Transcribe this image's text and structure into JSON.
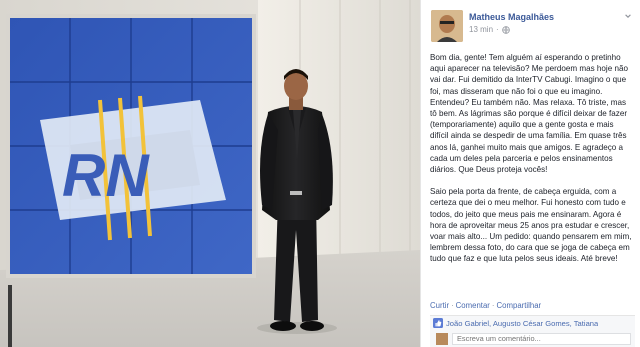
{
  "post": {
    "author": "Matheus Magalhães",
    "time": "13 min",
    "separator": "·",
    "paragraphs": [
      "Bom dia, gente! Tem alguém aí esperando o pretinho aqui aparecer na televisão? Me perdoem mas hoje não vai dar. Fui demitido da InterTV Cabugi. Imagino o que foi, mas disseram que não foi o que eu imagino. Entendeu? Eu também não. Mas relaxa. Tô triste, mas tô bem. As lágrimas são porque é difícil deixar de fazer (temporariamente) aquilo que a gente gosta e mais difícil ainda se despedir de uma família. Em quase três anos lá, ganhei muito mais que amigos. E agradeço a cada um deles pela parceria e pelos ensinamentos diários. Que Deus proteja vocês!",
      "Saio pela porta da frente, de cabeça erguida, com a certeza que dei o meu melhor. Fui honesto com tudo e todos, do jeito que meus pais me ensinaram. Agora é hora de aproveitar meus 25 anos pra estudar e crescer, voar mais alto... Um pedido: quando pensarem em mim, lembrem dessa foto, do cara que se joga de cabeça em tudo que faz e que luta pelos seus ideais. Até breve!"
    ]
  },
  "actions": {
    "like": "Curtir",
    "comment": "Comentar",
    "share": "Compartilhar",
    "dot": "·"
  },
  "likes": {
    "names": "João Gabriel, Augusto César Gomes, Tatiana"
  },
  "comment": {
    "placeholder": "Escreva um comentário..."
  },
  "photo": {
    "logo_text": "RN"
  },
  "colors": {
    "link": "#3b5998",
    "studio_blue": "#3a5db8",
    "suit": "#1b1b1d"
  }
}
